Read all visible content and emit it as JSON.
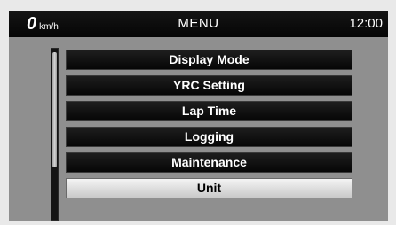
{
  "status_bar": {
    "speed_value": "0",
    "speed_unit": "km/h",
    "title": "MENU",
    "clock": "12:00"
  },
  "menu": {
    "items": [
      {
        "label": "Display Mode",
        "selected": false
      },
      {
        "label": "YRC Setting",
        "selected": false
      },
      {
        "label": "Lap Time",
        "selected": false
      },
      {
        "label": "Logging",
        "selected": false
      },
      {
        "label": "Maintenance",
        "selected": false
      },
      {
        "label": "Unit",
        "selected": true
      }
    ]
  }
}
